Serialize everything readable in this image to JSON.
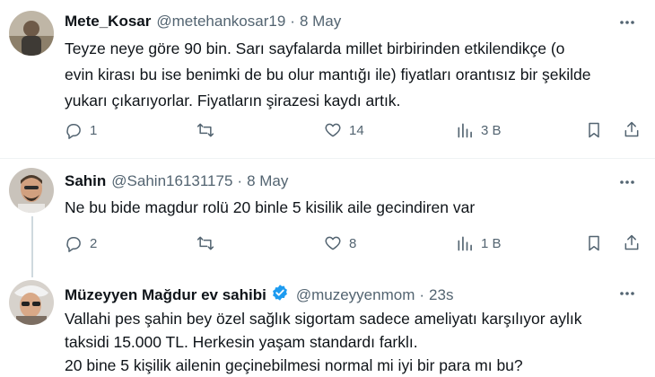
{
  "tweets": [
    {
      "name": "Mete_Kosar",
      "handle": "@metehankosar19",
      "separator": "·",
      "time": "8 May",
      "text_lines": [
        "Teyze neye göre 90 bin. Sarı sayfalarda millet birbirinden etkilendikçe (o",
        "evin kirası bu ise benimki de bu olur mantığı ile) fiyatları orantısız bir şekilde",
        "yukarı çıkarıyorlar. Fiyatların şirazesi kaydı artık."
      ],
      "replies": "1",
      "reposts": "",
      "likes": "14",
      "views": "3 B"
    },
    {
      "name": "Sahin",
      "handle": "@Sahin16131175",
      "separator": "·",
      "time": "8 May",
      "text_lines": [
        "Ne bu bide magdur rolü 20 binle 5 kisilik aile gecindiren var"
      ],
      "replies": "2",
      "reposts": "",
      "likes": "8",
      "views": "1 B"
    },
    {
      "name": "Müzeyyen Mağdur ev sahibi",
      "verified": true,
      "handle": "@muzeyyenmom",
      "separator": "·",
      "time": "23s",
      "text_lines": [
        "Vallahi pes şahin bey özel sağlık sigortam sadece ameliyatı karşılıyor aylık",
        "taksidi 15.000 TL. Herkesin yaşam standardı farklı.",
        "20 bine 5 kişilik ailenin geçinebilmesi normal mi iyi bir para mı bu?"
      ]
    }
  ],
  "icons": {
    "reply": "reply-icon",
    "repost": "repost-icon",
    "like": "heart-icon",
    "views": "views-icon",
    "bookmark": "bookmark-icon",
    "share": "share-icon",
    "more": "more-icon",
    "verified": "verified-badge-icon"
  },
  "colors": {
    "text": "#0f1419",
    "secondary": "#536471",
    "verified": "#1d9bf0",
    "divider": "#eff3f4",
    "thread_line": "#cfd9de"
  }
}
